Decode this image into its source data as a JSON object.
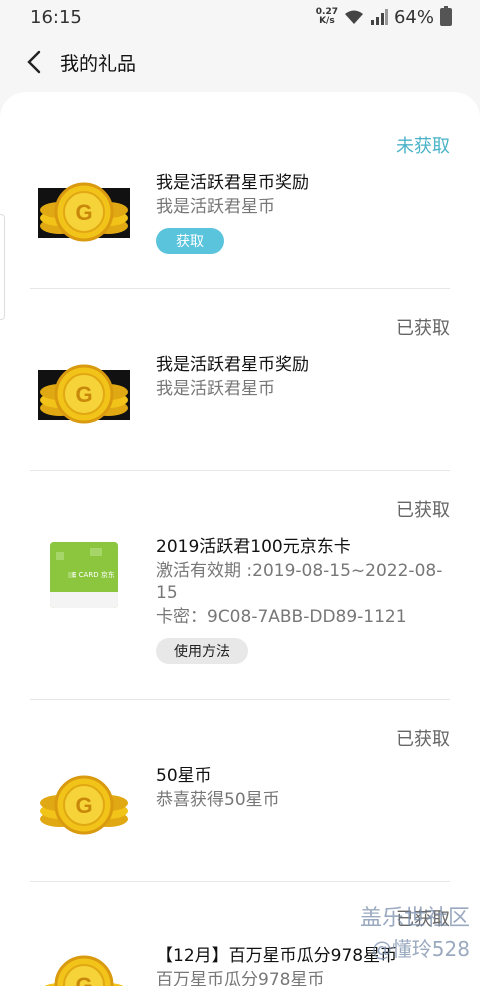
{
  "status_bar": {
    "time": "16:15",
    "net_speed_value": "0.27",
    "net_speed_unit": "K/s",
    "battery": "64%"
  },
  "header": {
    "title": "我的礼品"
  },
  "gifts": [
    {
      "status": "未获取",
      "title": "我是活跃君星币奖励",
      "subtitle": "我是活跃君星币",
      "button": "获取",
      "icon": "gold-coins-icon"
    },
    {
      "status": "已获取",
      "title": "我是活跃君星币奖励",
      "subtitle": "我是活跃君星币",
      "icon": "gold-coins-icon"
    },
    {
      "status": "已获取",
      "title": "2019活跃君100元京东卡",
      "validity": "激活有效期 :2019-08-15~2022-08-15",
      "card_code": "卡密：9C08-7ABB-DD89-1121",
      "button": "使用方法",
      "icon": "jd-gift-card-icon",
      "card_label": "E CARD 京东"
    },
    {
      "status": "已获取",
      "title": "50星币",
      "subtitle": "恭喜获得50星币",
      "icon": "gold-coins-icon"
    },
    {
      "status": "已获取",
      "title": "【12月】百万星币瓜分978星币",
      "subtitle": "百万星币瓜分978星币",
      "icon": "gold-coins-icon"
    }
  ],
  "watermark": {
    "site": "盖乐世社区",
    "user": "@懂玲528"
  },
  "colors": {
    "pending": "#4ab3c8",
    "button_blue": "#5bc4dd",
    "coin": "#f2c318"
  }
}
